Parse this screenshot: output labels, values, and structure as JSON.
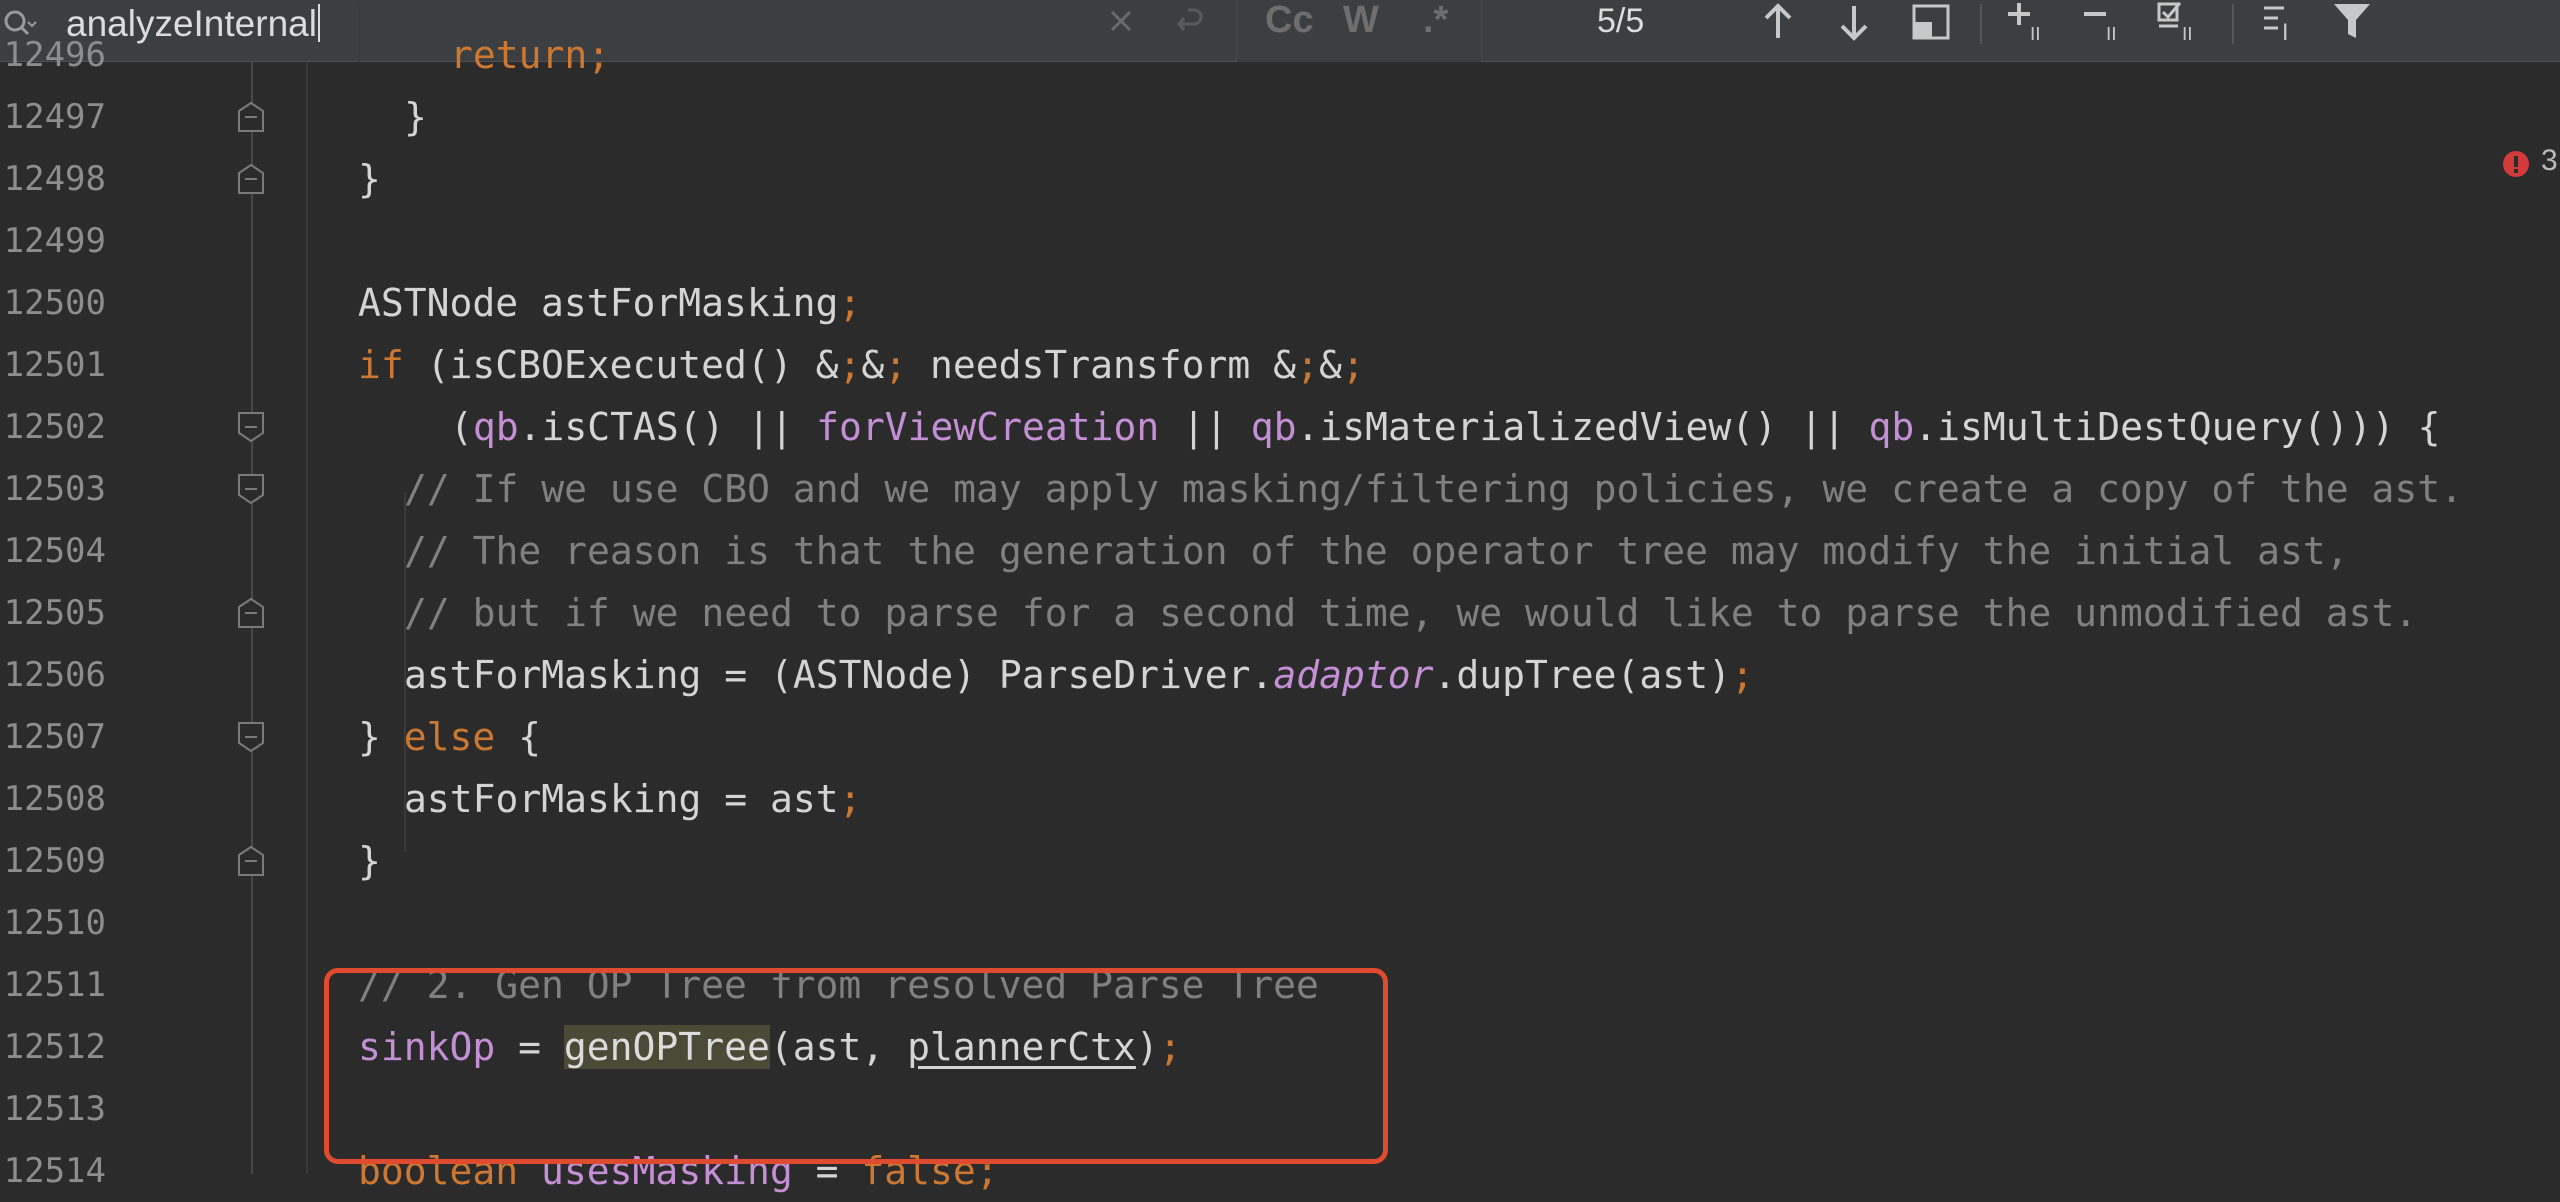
{
  "search": {
    "query": "analyzeInternal",
    "options": {
      "match_case": "Cc",
      "words": "W",
      "regex": ".*"
    },
    "match_count": "5/5"
  },
  "inspections": {
    "error_count": "3"
  },
  "colors": {
    "keyword": "#cc7832",
    "comment": "#808080",
    "field": "#c58fd6",
    "highlight_box": "#e04a2f"
  },
  "editor": {
    "lines": [
      {
        "num": "12497",
        "text": "}"
      },
      {
        "num": "12498",
        "text": "}"
      },
      {
        "num": "12499",
        "text": ""
      },
      {
        "num": "12500",
        "text": "ASTNode astForMasking;"
      },
      {
        "num": "12501",
        "text": "if (isCBOExecuted() && needsTransform &&"
      },
      {
        "num": "12502",
        "text": "(qb.isCTAS() || forViewCreation || qb.isMaterializedView() || qb.isMultiDestQuery())) {"
      },
      {
        "num": "12503",
        "text": "// If we use CBO and we may apply masking/filtering policies, we create a copy of the ast."
      },
      {
        "num": "12504",
        "text": "// The reason is that the generation of the operator tree may modify the initial ast,"
      },
      {
        "num": "12505",
        "text": "// but if we need to parse for a second time, we would like to parse the unmodified ast."
      },
      {
        "num": "12506",
        "text": "astForMasking = (ASTNode) ParseDriver.adaptor.dupTree(ast);"
      },
      {
        "num": "12507",
        "text": "} else {"
      },
      {
        "num": "12508",
        "text": "astForMasking = ast;"
      },
      {
        "num": "12509",
        "text": "}"
      },
      {
        "num": "12510",
        "text": ""
      },
      {
        "num": "12511",
        "text": "// 2. Gen OP Tree from resolved Parse Tree"
      },
      {
        "num": "12512",
        "text": "sinkOp = genOPTree(ast, plannerCtx);"
      },
      {
        "num": "12513",
        "text": ""
      },
      {
        "num": "12514",
        "text": "boolean usesMasking = false;"
      }
    ],
    "partial_top_line": {
      "num": "12496",
      "text": "return;"
    }
  }
}
